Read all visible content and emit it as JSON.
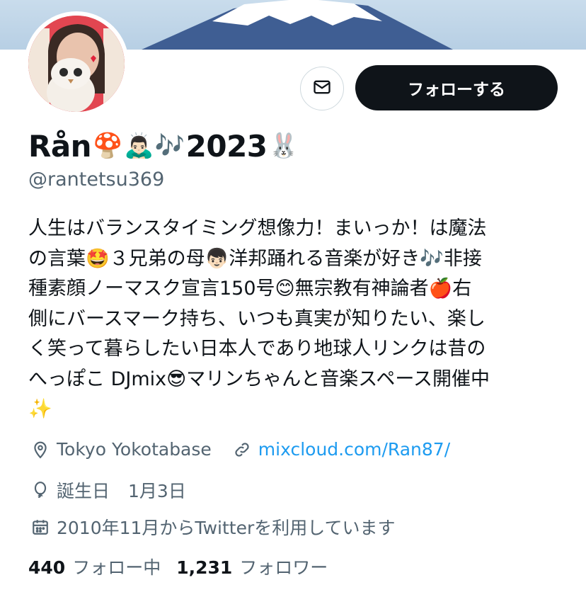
{
  "profile": {
    "display_name": "Rån",
    "display_name_year": "2023",
    "handle": "@rantetsu369",
    "bio_lines": [
      "人生はバランスタイミング想像力！まいっか！は魔法",
      "の言葉🤩３兄弟の母👦🏻洋邦踊れる音楽が好き🎶非接",
      "種素顔ノーマスク宣言150号😊無宗教有神論者🍎右",
      "側にバースマーク持ち、いつも真実が知りたい、楽し",
      "く笑って暮らしたい日本人であり地球人リンクは昔の",
      "へっぽこ DJmix😎マリンちゃんと音楽スペース開催中",
      "✨"
    ],
    "location": "Tokyo Yokotabase",
    "website": "mixcloud.com/Ran87/",
    "birthday_label": "誕生日",
    "birthday_value": "1月3日",
    "joined": "2010年11月からTwitterを利用しています",
    "following_count": "440",
    "following_label": "フォロー中",
    "followers_count": "1,231",
    "followers_label": "フォロワー"
  },
  "actions": {
    "follow_label": "フォローする"
  },
  "icons": {
    "message": "envelope-icon",
    "location": "map-pin-icon",
    "link": "link-icon",
    "birthday": "balloon-icon",
    "joined": "calendar-icon"
  },
  "colors": {
    "text": "#0f1419",
    "secondary": "#536471",
    "link": "#1d9bf0",
    "button": "#0f1419",
    "avatar_bg": "#e24651"
  }
}
